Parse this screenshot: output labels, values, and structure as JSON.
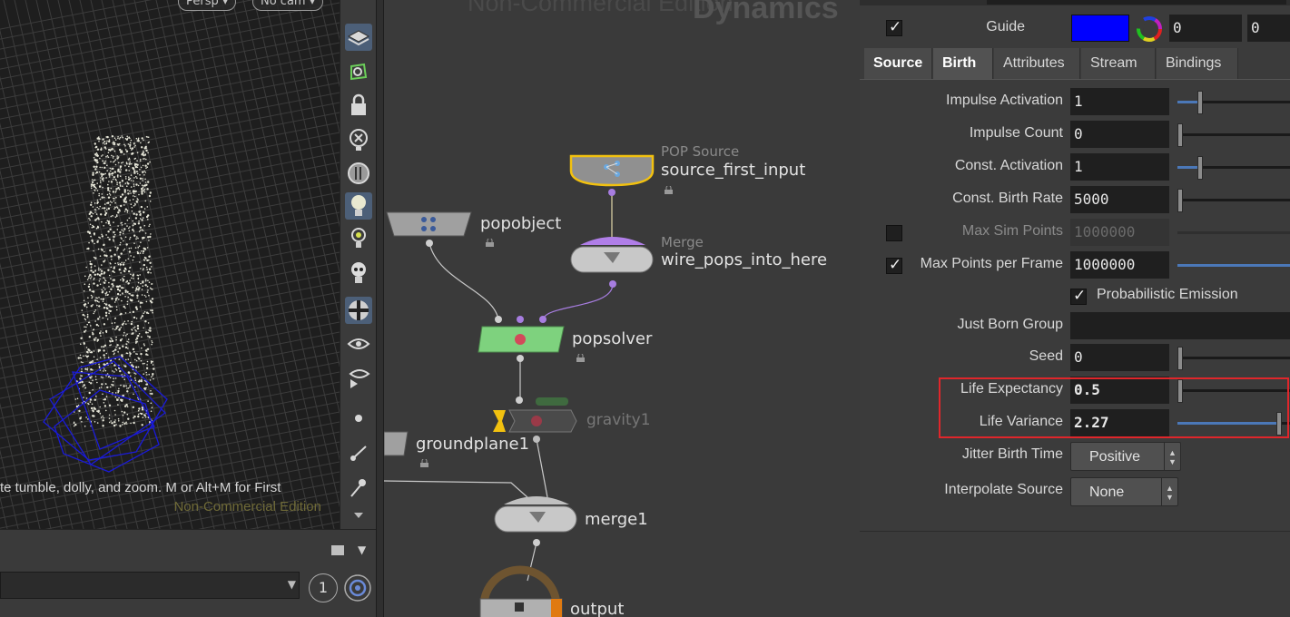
{
  "viewport": {
    "persp_label": "Persp ▾",
    "cam_label": "No cam ▾",
    "hint_text": "te tumble, dolly, and zoom. M or Alt+M for First",
    "watermark": "Non-Commercial Edition"
  },
  "bottom_strip": {
    "count": "1"
  },
  "network": {
    "watermark_edition": "Non-Commercial Edition",
    "watermark_context": "Dynamics",
    "nodes": {
      "source": {
        "type": "POP Source",
        "name": "source_first_input"
      },
      "popobject": {
        "name": "popobject"
      },
      "merge_wire": {
        "type": "Merge",
        "name": "wire_pops_into_here"
      },
      "popsolver": {
        "name": "popsolver"
      },
      "gravity": {
        "name": "gravity1"
      },
      "groundplane": {
        "name": "groundplane1"
      },
      "merge1": {
        "name": "merge1"
      },
      "output": {
        "name": "output"
      }
    }
  },
  "params": {
    "guide": {
      "label": "Guide",
      "color": "#0000ff",
      "value1": "0",
      "value2": "0"
    },
    "tabs": [
      {
        "label": "Source"
      },
      {
        "label": "Birth"
      },
      {
        "label": "Attributes"
      },
      {
        "label": "Stream"
      },
      {
        "label": "Bindings"
      }
    ],
    "rows": {
      "impulse_activation": {
        "label": "Impulse Activation",
        "value": "1",
        "slider": 0.2
      },
      "impulse_count": {
        "label": "Impulse Count",
        "value": "0",
        "slider": 0.0
      },
      "const_activation": {
        "label": "Const. Activation",
        "value": "1",
        "slider": 0.2
      },
      "const_birth_rate": {
        "label": "Const. Birth Rate",
        "value": "5000",
        "slider": 0.0
      },
      "max_sim_points": {
        "label": "Max Sim Points",
        "value": "1000000"
      },
      "max_points_per_frame": {
        "label": "Max Points per Frame",
        "value": "1000000",
        "slider": 1.0
      },
      "probabilistic_emission": {
        "label": "Probabilistic Emission"
      },
      "just_born_group": {
        "label": "Just Born Group",
        "value": ""
      },
      "seed": {
        "label": "Seed",
        "value": "0",
        "slider": 0.0
      },
      "life_expectancy": {
        "label": "Life Expectancy",
        "value": "0.5",
        "slider": 0.0
      },
      "life_variance": {
        "label": "Life Variance",
        "value": "2.27",
        "slider": 0.9
      },
      "jitter_birth_time": {
        "label": "Jitter Birth Time",
        "value": "Positive"
      },
      "interpolate_source": {
        "label": "Interpolate Source",
        "value": "None"
      }
    }
  },
  "colors": {
    "accent_highlight": "#e0262b",
    "selected_node": "#f2c10f",
    "solver_node": "#7ed27e",
    "wire_purple": "#a77de0"
  }
}
